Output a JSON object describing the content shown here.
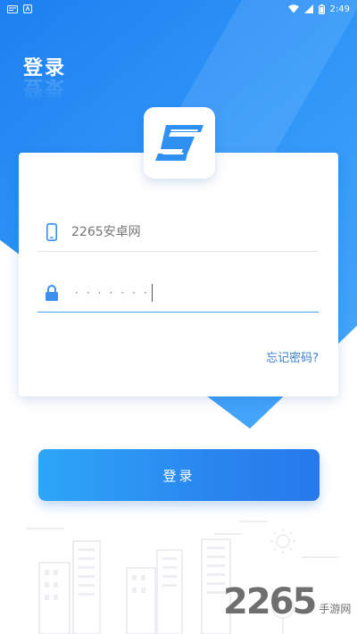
{
  "status_bar": {
    "time": "2:49",
    "battery_icon": "battery-icon",
    "wifi_icon": "wifi-icon",
    "signal_icon": "signal-icon"
  },
  "page": {
    "title": "登录"
  },
  "logo": {
    "icon": "app-logo-icon",
    "color": "#2f8ff3"
  },
  "form": {
    "username": {
      "placeholder": "2265安卓网",
      "icon": "phone-icon"
    },
    "password": {
      "value": "·······",
      "icon": "lock-icon"
    },
    "forgot_label": "忘记密码?",
    "submit_label": "登录"
  },
  "watermark": {
    "number": "2265",
    "site": "手游网"
  },
  "colors": {
    "primary": "#2a86ef",
    "link": "#3a7fcf"
  }
}
